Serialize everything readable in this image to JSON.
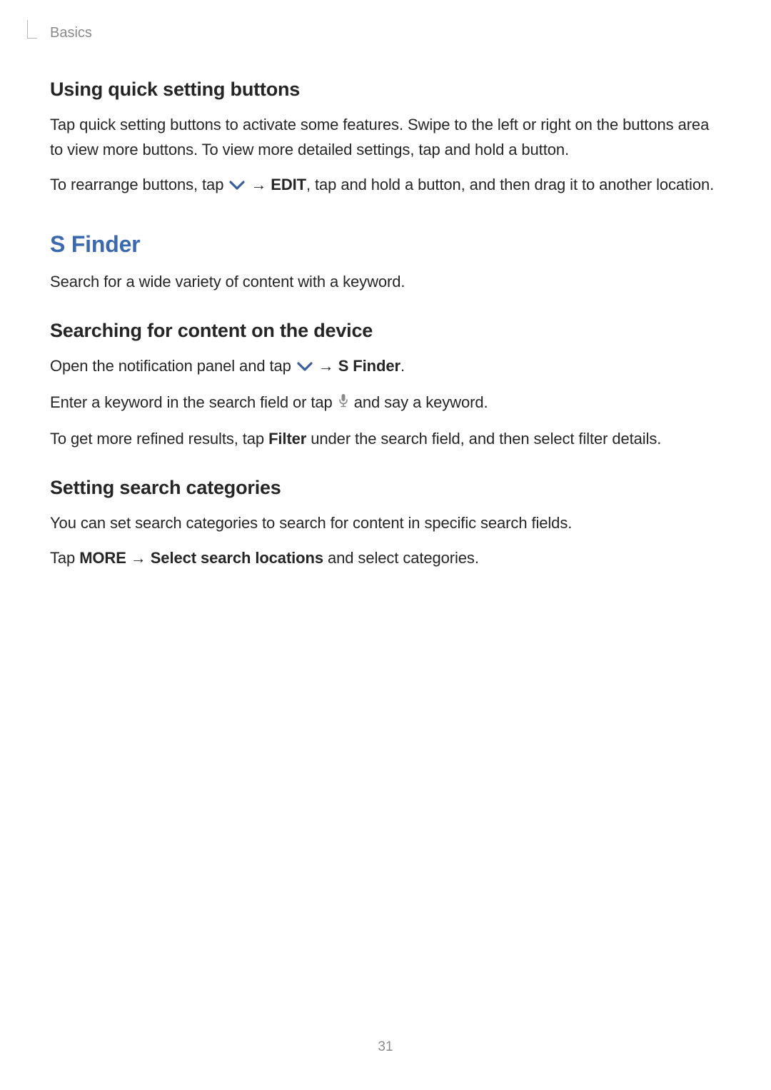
{
  "breadcrumb": "Basics",
  "section1": {
    "heading": "Using quick setting buttons",
    "p1": "Tap quick setting buttons to activate some features. Swipe to the left or right on the buttons area to view more buttons. To view more detailed settings, tap and hold a button.",
    "p2_prefix": "To rearrange buttons, tap ",
    "p2_arrow": " → ",
    "p2_edit": "EDIT",
    "p2_suffix": ", tap and hold a button, and then drag it to another location."
  },
  "section2": {
    "heading": "S Finder",
    "intro": "Search for a wide variety of content with a keyword.",
    "sub1": {
      "heading": "Searching for content on the device",
      "p1_prefix": "Open the notification panel and tap ",
      "p1_arrow": " → ",
      "p1_sfinder": "S Finder",
      "p1_suffix": ".",
      "p2_prefix": "Enter a keyword in the search field or tap ",
      "p2_suffix": " and say a keyword.",
      "p3_prefix": "To get more refined results, tap ",
      "p3_filter": "Filter",
      "p3_suffix": " under the search field, and then select filter details."
    },
    "sub2": {
      "heading": "Setting search categories",
      "p1": "You can set search categories to search for content in specific search fields.",
      "p2_prefix": "Tap ",
      "p2_more": "MORE",
      "p2_arrow": " → ",
      "p2_locations": "Select search locations",
      "p2_suffix": " and select categories."
    }
  },
  "page_number": "31"
}
